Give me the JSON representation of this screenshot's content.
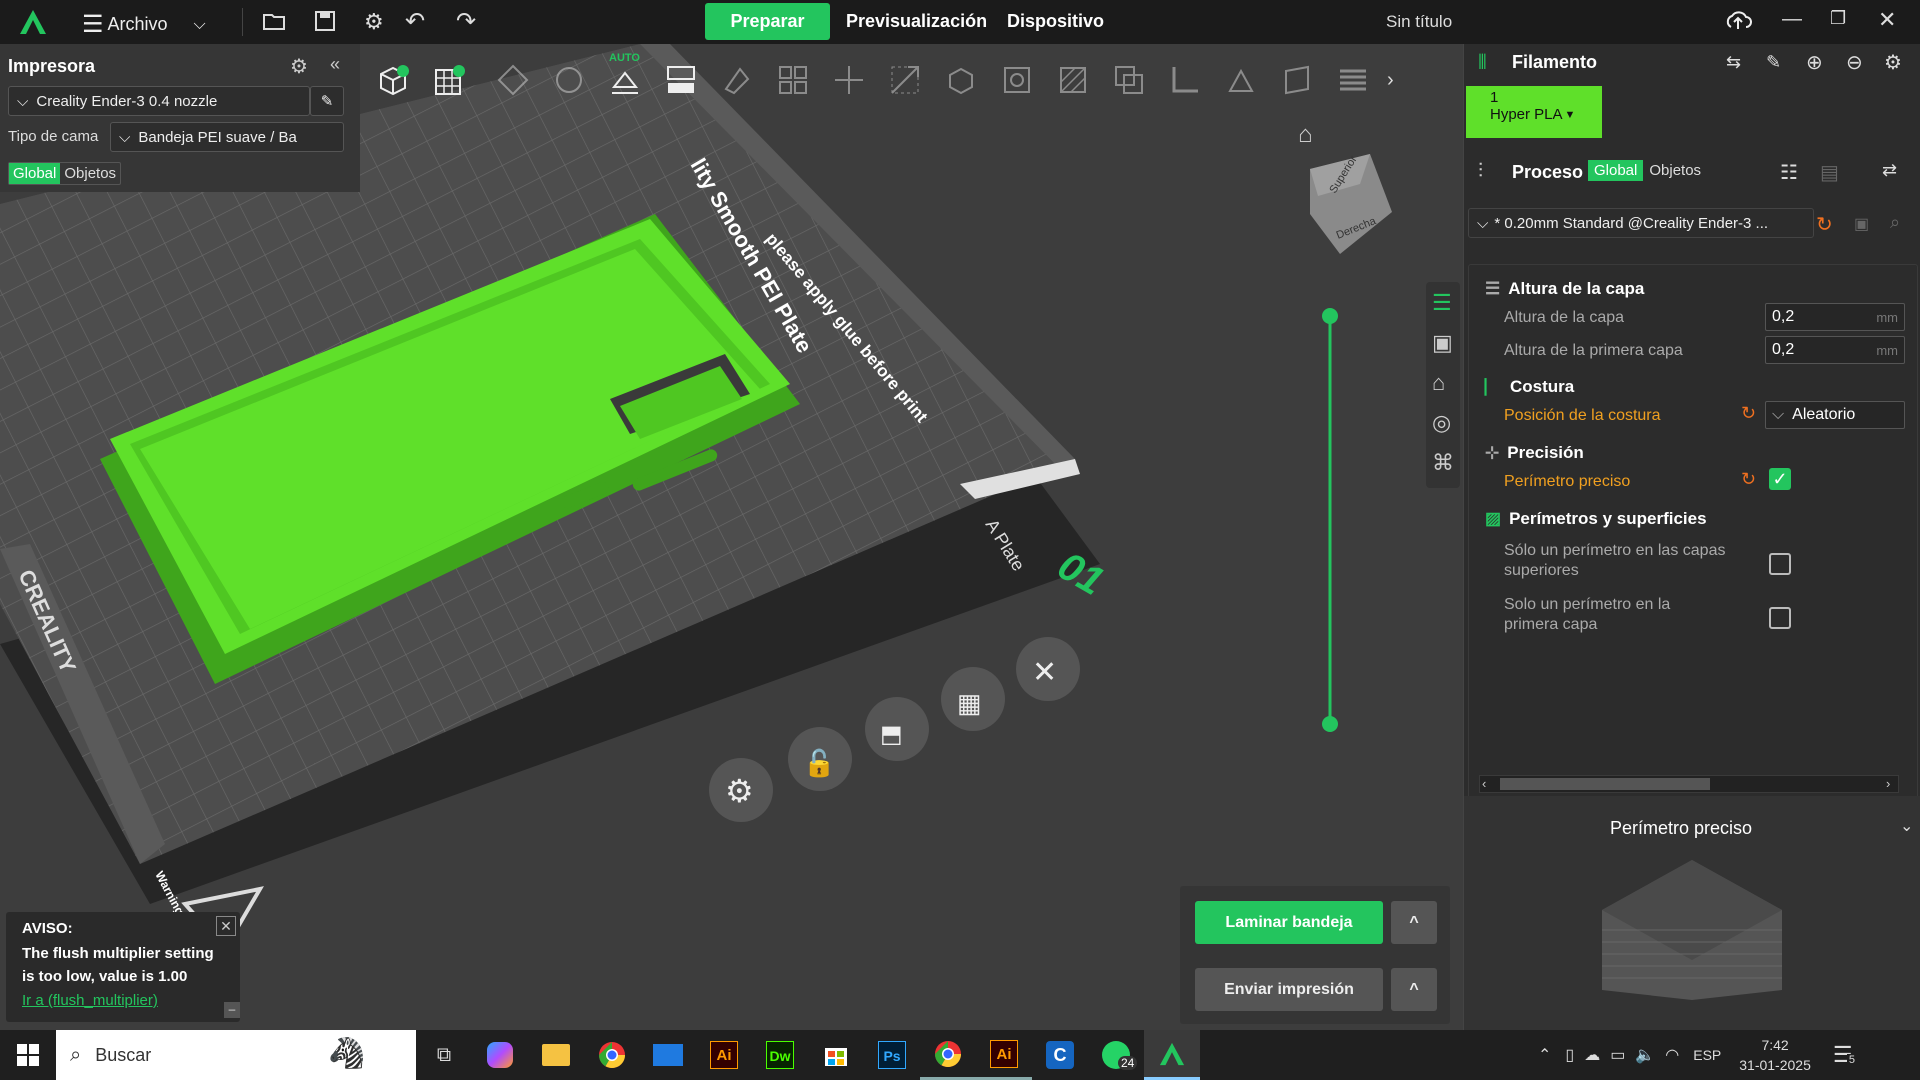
{
  "titlebar": {
    "menu_label": "Archivo",
    "tabs": [
      {
        "label": "Preparar",
        "active": true
      },
      {
        "label": "Previsualización",
        "active": false
      },
      {
        "label": "Dispositivo",
        "active": false
      }
    ],
    "doc_title": "Sin título"
  },
  "printer_panel": {
    "title": "Impresora",
    "printer_name": "Creality Ender-3 0.4 nozzle",
    "bed_label": "Tipo de cama",
    "bed_value": "Bandeja PEI suave / Ba",
    "tabs": [
      "Global",
      "Objetos"
    ]
  },
  "toolbar": {
    "auto_label": "AUTO"
  },
  "viewport": {
    "plate_text_1": "lity Smooth PEI Plate",
    "plate_text_2": "please apply glue before print",
    "plate_text_3": "A Plate",
    "plate_number": "01",
    "brand": "CREALITY",
    "warning": "Warning hot surface",
    "view_cube_top": "Superior",
    "view_cube_right": "Derecha",
    "auto_badge": "AUTO"
  },
  "notice": {
    "title": "AVISO:",
    "message": "The flush multiplier setting is too low, value is 1.00",
    "link": "Ir a (flush_multiplier)"
  },
  "actions": {
    "slice_label": "Laminar bandeja",
    "print_label": "Enviar impresión",
    "caret": "^"
  },
  "filament": {
    "title": "Filamento",
    "slot_number": "1",
    "slot_name": "Hyper PLA",
    "color": "#5fe02a"
  },
  "process": {
    "title": "Proceso",
    "tabs": [
      "Global",
      "Objetos"
    ],
    "preset": "* 0.20mm Standard @Creality Ender-3 ...",
    "sections": [
      {
        "title": "Altura de la capa"
      },
      {
        "title": "Costura"
      },
      {
        "title": "Precisión"
      },
      {
        "title": "Perímetros y superficies"
      }
    ],
    "params": {
      "layer_height_label": "Altura de la capa",
      "layer_height_value": "0,2",
      "first_layer_label": "Altura de la primera capa",
      "first_layer_value": "0,2",
      "unit": "mm",
      "seam_label": "Posición de la costura",
      "seam_value": "Aleatorio",
      "precise_label": "Perímetro preciso",
      "top_one_wall_line1": "Sólo un perímetro en las capas",
      "top_one_wall_line2": "superiores",
      "first_one_wall_line1": "Solo un perímetro en la",
      "first_one_wall_line2": "primera capa"
    }
  },
  "help_panel": {
    "title": "Perímetro preciso"
  },
  "taskbar": {
    "search_placeholder": "Buscar",
    "lang": "ESP",
    "time": "7:42",
    "date": "31-01-2025",
    "whatsapp_badge": "24",
    "notif_count": "5"
  },
  "colors": {
    "accent": "#23c55e",
    "model": "#5fe02a",
    "warn": "#f0a020"
  }
}
